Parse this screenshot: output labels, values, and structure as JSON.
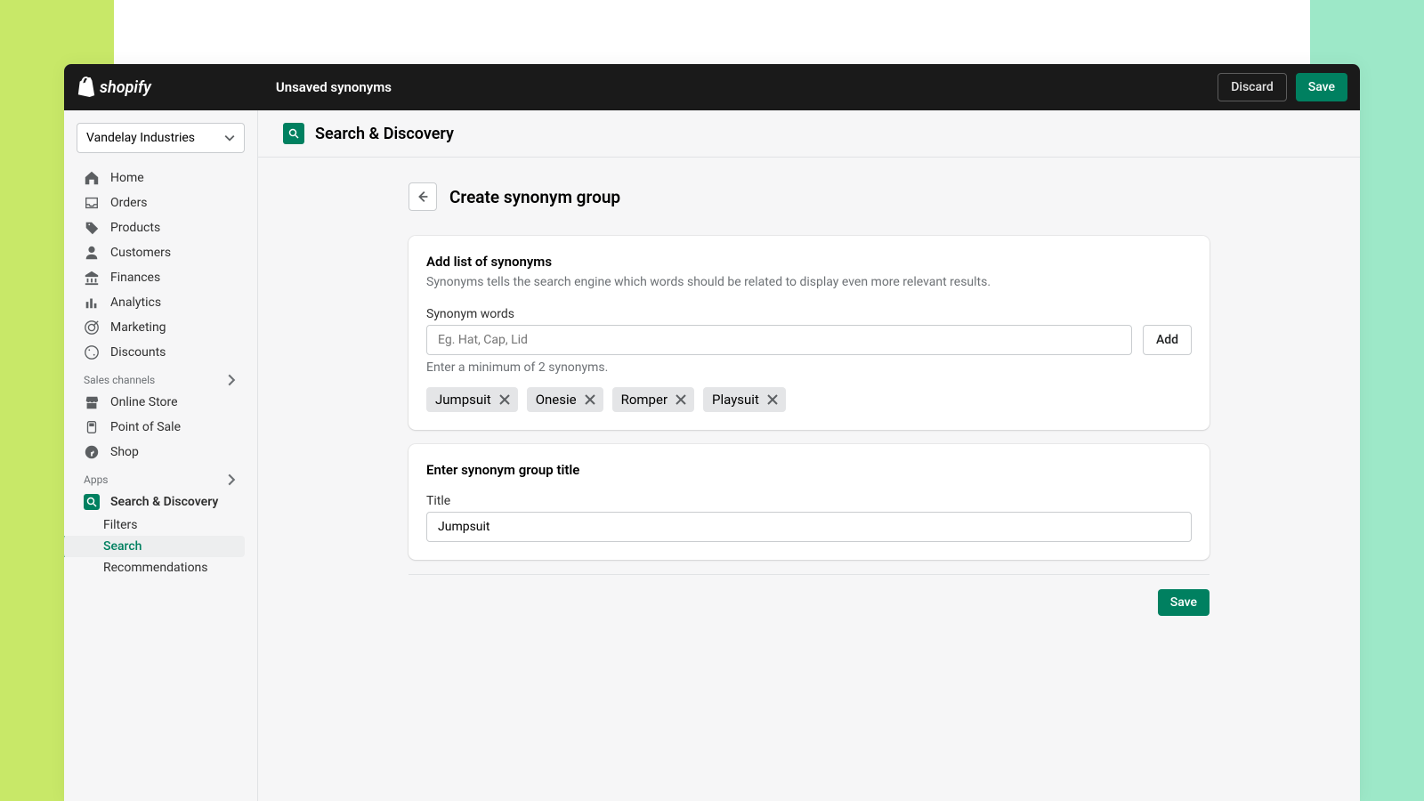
{
  "brand": "shopify",
  "topbar": {
    "title": "Unsaved synonyms",
    "discard": "Discard",
    "save": "Save"
  },
  "store_selector": "Vandelay Industries",
  "nav": {
    "items": [
      {
        "label": "Home",
        "icon": "home"
      },
      {
        "label": "Orders",
        "icon": "inbox"
      },
      {
        "label": "Products",
        "icon": "tag"
      },
      {
        "label": "Customers",
        "icon": "person"
      },
      {
        "label": "Finances",
        "icon": "bank"
      },
      {
        "label": "Analytics",
        "icon": "bars"
      },
      {
        "label": "Marketing",
        "icon": "target"
      },
      {
        "label": "Discounts",
        "icon": "discount"
      }
    ],
    "sales_channels_label": "Sales channels",
    "channels": [
      {
        "label": "Online Store",
        "icon": "store"
      },
      {
        "label": "Point of Sale",
        "icon": "pos"
      },
      {
        "label": "Shop",
        "icon": "shop"
      }
    ],
    "apps_label": "Apps",
    "app": "Search & Discovery",
    "app_subnav": [
      "Filters",
      "Search",
      "Recommendations"
    ],
    "active_subnav": "Search"
  },
  "main": {
    "app_title": "Search & Discovery",
    "page_title": "Create synonym group",
    "card1": {
      "title": "Add list of synonyms",
      "desc": "Synonyms tells the search engine which words should be related to display even more relevant results.",
      "field_label": "Synonym words",
      "placeholder": "Eg. Hat, Cap, Lid",
      "add_btn": "Add",
      "helper": "Enter a minimum of 2 synonyms.",
      "tags": [
        "Jumpsuit",
        "Onesie",
        "Romper",
        "Playsuit"
      ]
    },
    "card2": {
      "title": "Enter synonym group title",
      "field_label": "Title",
      "value": "Jumpsuit"
    },
    "footer_save": "Save"
  }
}
